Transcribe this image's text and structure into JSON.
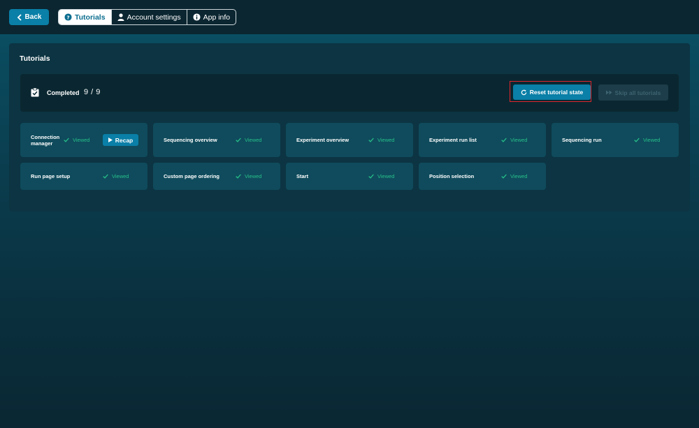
{
  "topbar": {
    "back_label": "Back",
    "tabs": [
      {
        "label": "Tutorials",
        "icon": "question-circle-icon",
        "active": true
      },
      {
        "label": "Account settings",
        "icon": "user-icon",
        "active": false
      },
      {
        "label": "App info",
        "icon": "info-circle-icon",
        "active": false
      }
    ]
  },
  "panel": {
    "title": "Tutorials",
    "completed_label": "Completed",
    "completed_count": "9 / 9",
    "reset_label": "Reset tutorial state",
    "skip_label": "Skip all tutorials"
  },
  "tutorials": [
    {
      "title": "Connection manager",
      "status": "Viewed",
      "action": "Recap"
    },
    {
      "title": "Sequencing overview",
      "status": "Viewed"
    },
    {
      "title": "Experiment overview",
      "status": "Viewed"
    },
    {
      "title": "Experiment run list",
      "status": "Viewed"
    },
    {
      "title": "Sequencing run",
      "status": "Viewed"
    },
    {
      "title": "Run page setup",
      "status": "Viewed"
    },
    {
      "title": "Custom page ordering",
      "status": "Viewed"
    },
    {
      "title": "Start",
      "status": "Viewed"
    },
    {
      "title": "Position selection",
      "status": "Viewed"
    }
  ],
  "colors": {
    "accent": "#0a7fa7",
    "viewed": "#27c08a",
    "highlight_border": "#e0242c"
  }
}
